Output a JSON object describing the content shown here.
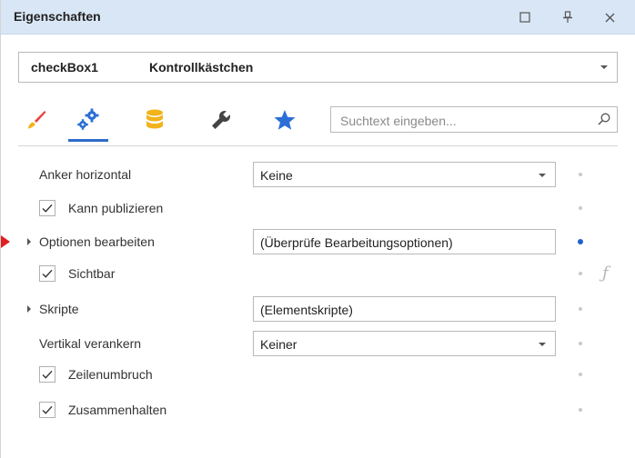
{
  "window": {
    "title": "Eigenschaften"
  },
  "titlebar_buttons": {
    "maximize_glyph": "□",
    "pin_glyph": "📌",
    "close_glyph": "✕"
  },
  "object_selector": {
    "name": "checkBox1",
    "type": "Kontrollkästchen"
  },
  "tabs": [
    {
      "icon": "brush-icon",
      "active": false
    },
    {
      "icon": "gears-icon",
      "active": true
    },
    {
      "icon": "database-icon",
      "active": false
    },
    {
      "icon": "wrench-icon",
      "active": false
    },
    {
      "icon": "star-icon",
      "active": false
    }
  ],
  "search": {
    "placeholder": "Suchtext eingeben..."
  },
  "properties": {
    "anker_horizontal": {
      "label": "Anker horizontal",
      "value": "Keine"
    },
    "kann_publizieren": {
      "label": "Kann publizieren",
      "checked": true
    },
    "optionen_bearbeiten": {
      "label": "Optionen bearbeiten",
      "value": "(Überprüfe Bearbeitungsoptionen)"
    },
    "sichtbar": {
      "label": "Sichtbar",
      "checked": true
    },
    "skripte": {
      "label": "Skripte",
      "value": "(Elementskripte)"
    },
    "vertikal_verankern": {
      "label": "Vertikal verankern",
      "value": "Keiner"
    },
    "zeilenumbruch": {
      "label": "Zeilenumbruch",
      "checked": true
    },
    "zusammenhalten": {
      "label": "Zusammenhalten",
      "checked": true
    }
  },
  "function_glyph": "ƒ",
  "colors": {
    "titlebar": "#d9e6f5",
    "accent": "#2d6cc9",
    "marker": "#e02020",
    "brush": "#e7433f",
    "database": "#f2b31b",
    "star": "#2b6fd6"
  }
}
